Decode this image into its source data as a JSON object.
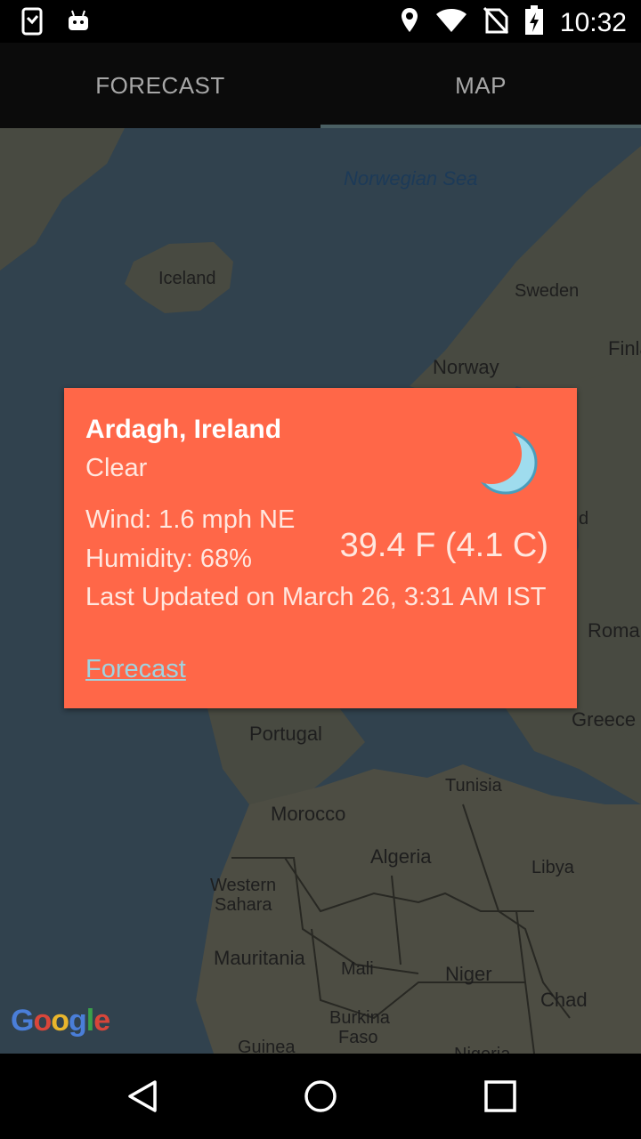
{
  "status_bar": {
    "time": "10:32",
    "left_icons": [
      "screen-rotate-icon",
      "android-icon"
    ],
    "right_icons": [
      "location-icon",
      "wifi-icon",
      "no-sim-icon",
      "battery-charging-icon"
    ]
  },
  "tabs": [
    {
      "label": "FORECAST",
      "selected": false
    },
    {
      "label": "MAP",
      "selected": true
    }
  ],
  "map": {
    "labels": {
      "norwegian_sea": "Norwegian Sea",
      "iceland": "Iceland",
      "sweden": "Sweden",
      "finland": "Finla",
      "norway": "Norway",
      "finland_partial": "d",
      "romania": "Roma",
      "greece": "Greece",
      "portugal": "Portugal",
      "tunisia": "Tunisia",
      "morocco": "Morocco",
      "algeria": "Algeria",
      "libya": "Libya",
      "western_sahara_1": "Western",
      "western_sahara_2": "Sahara",
      "mauritania": "Mauritania",
      "mali": "Mali",
      "niger": "Niger",
      "chad": "Chad",
      "burkina_1": "Burkina",
      "burkina_2": "Faso",
      "guinea": "Guinea",
      "nigeria": "Nigeria"
    },
    "logo": "Google"
  },
  "info_window": {
    "city": "Ardagh, Ireland",
    "condition": "Clear",
    "wind": "Wind: 1.6 mph NE",
    "humidity": "Humidity: 68%",
    "temperature": "39.4 F (4.1 C)",
    "last_updated": "Last Updated on March 26, 3:31 AM IST",
    "forecast_link": "Forecast",
    "icon": "moon-icon"
  },
  "nav_bar": {
    "buttons": [
      "back-icon",
      "home-icon",
      "recents-icon"
    ]
  },
  "colors": {
    "info_background": "#ff6748",
    "tab_indicator": "#4a5f63",
    "map_water": "#3a4e5c",
    "map_land": "#5a5a4e"
  }
}
